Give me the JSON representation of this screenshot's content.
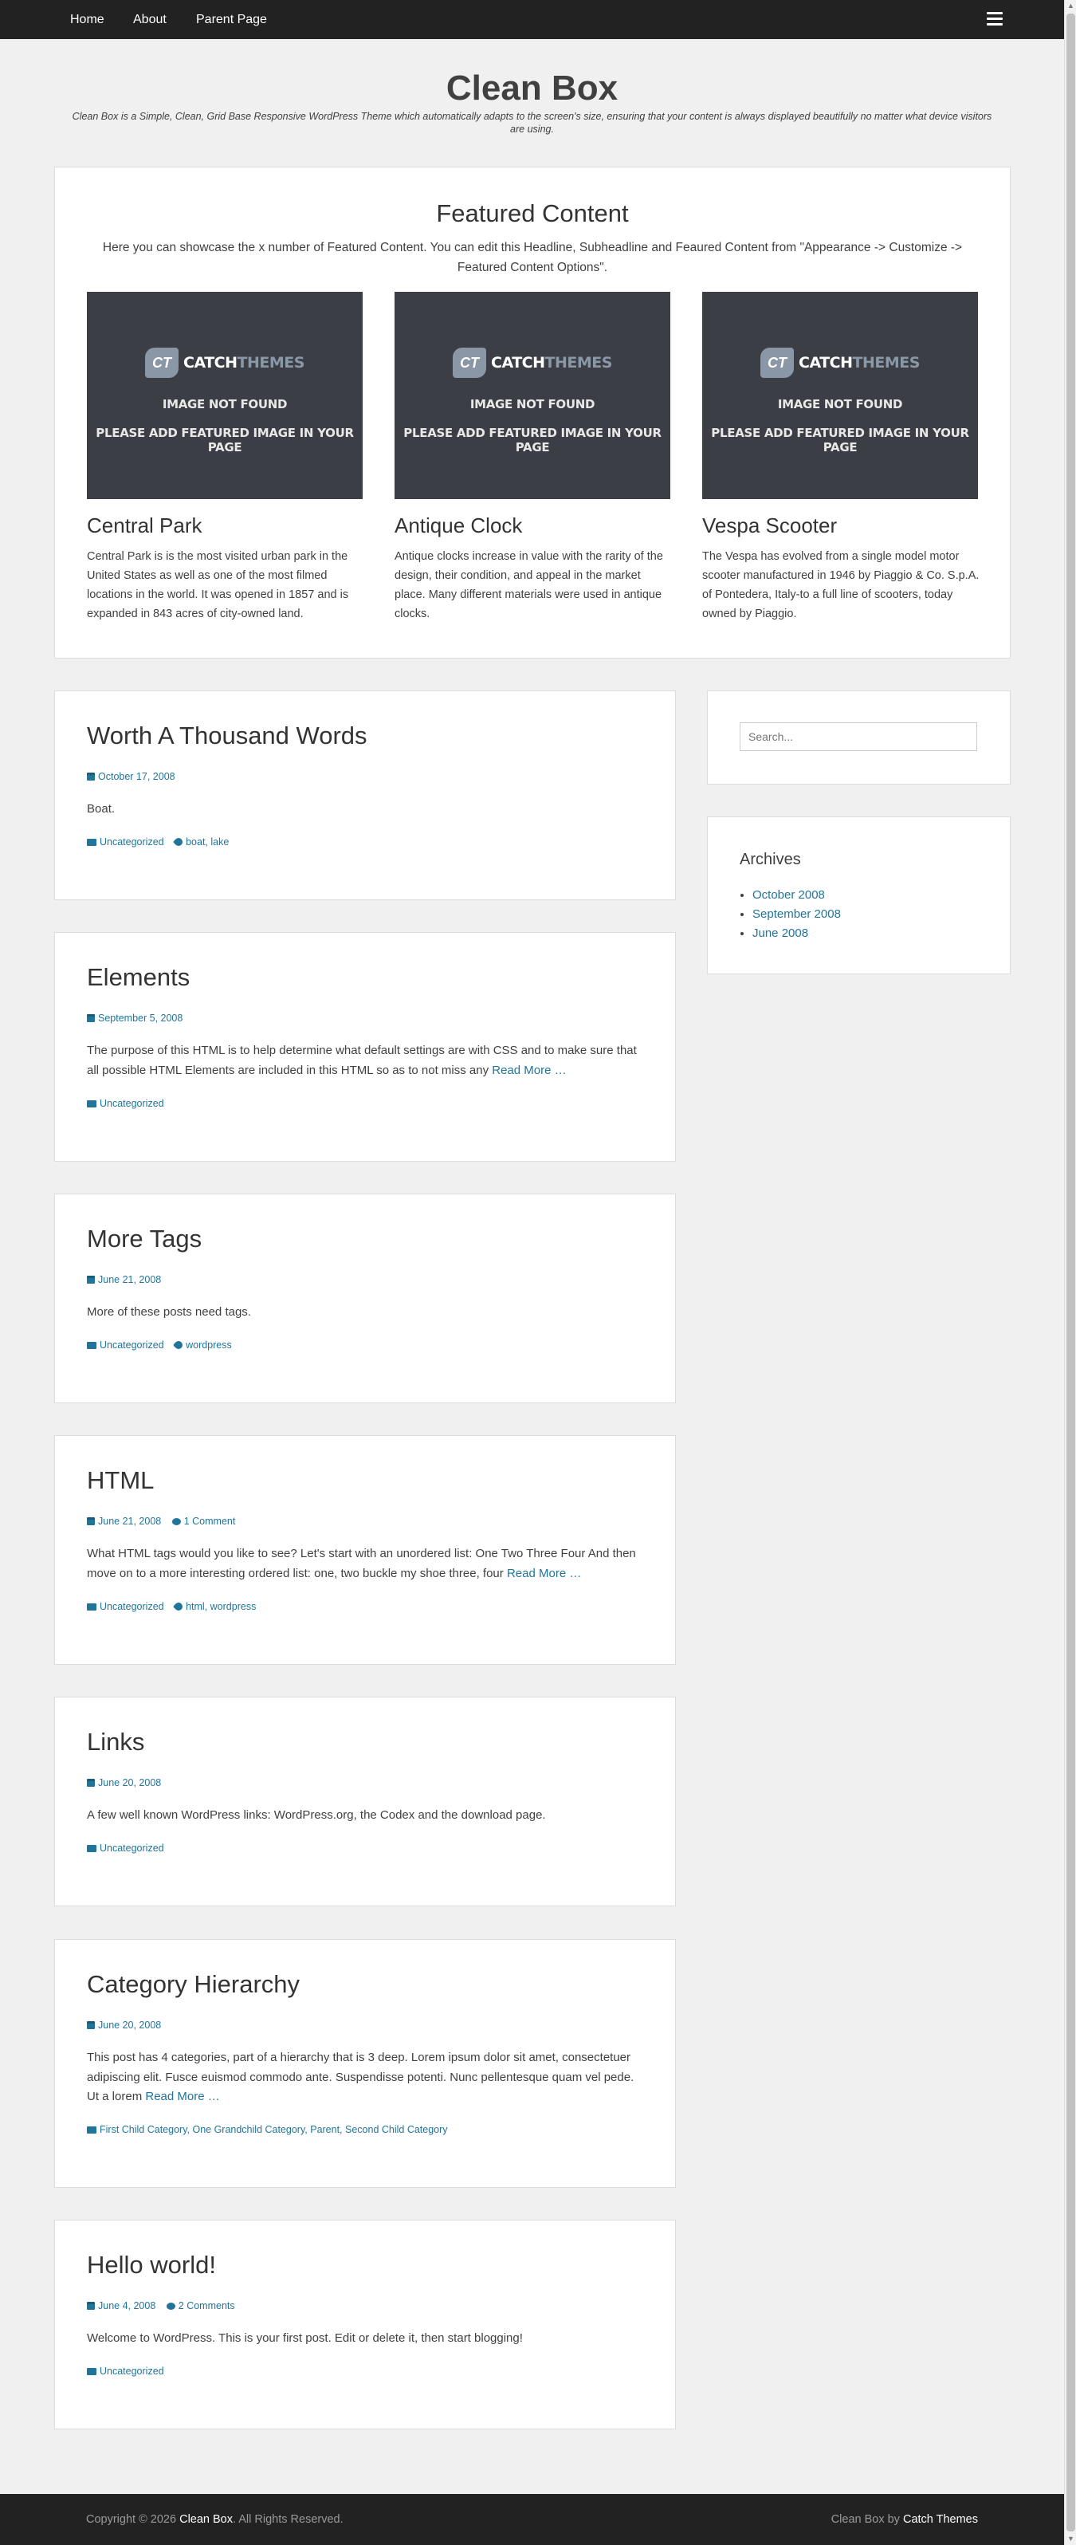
{
  "nav": {
    "items": [
      "Home",
      "About",
      "Parent Page"
    ]
  },
  "site": {
    "title": "Clean Box",
    "description": "Clean Box is a Simple, Clean, Grid Base Responsive WordPress Theme which automatically adapts to the screen's size, ensuring that your content is always displayed beautifully no matter what device visitors are using."
  },
  "featured": {
    "title": "Featured Content",
    "subtitle": "Here you can showcase the x number of Featured Content. You can edit this Headline, Subheadline and Feaured Content from \"Appearance -> Customize -> Featured Content Options\".",
    "placeholder": {
      "logo_badge": "CT",
      "logo_word1": "CATCH",
      "logo_word2": "THEMES",
      "line1": "IMAGE NOT FOUND",
      "line2": "PLEASE ADD FEATURED IMAGE IN YOUR PAGE"
    },
    "items": [
      {
        "title": "Central Park",
        "text": "Central Park is is the most visited urban park in the United States as well as one of the most filmed locations in the world. It was opened in 1857 and is expanded in 843 acres of city-owned land."
      },
      {
        "title": "Antique Clock",
        "text": "Antique clocks increase in value with the rarity of the design, their condition, and appeal in the market place. Many different materials were used in antique clocks."
      },
      {
        "title": "Vespa Scooter",
        "text": "The Vespa has evolved from a single model motor scooter manufactured in 1946 by Piaggio & Co. S.p.A. of Pontedera, Italy-to a full line of scooters, today owned by Piaggio."
      }
    ]
  },
  "read_more": "Read More …",
  "posts": [
    {
      "title": "Worth A Thousand Words",
      "date": "October 17, 2008",
      "excerpt": "Boat.",
      "categories": "Uncategorized",
      "tags": "boat, lake"
    },
    {
      "title": "Elements",
      "date": "September 5, 2008",
      "excerpt": "The purpose of this HTML is to help determine what default settings are with CSS and to make sure that all possible HTML Elements are included in this HTML so as to not miss any",
      "categories": "Uncategorized"
    },
    {
      "title": "More Tags",
      "date": "June 21, 2008",
      "excerpt": "More of these posts need tags.",
      "categories": "Uncategorized",
      "tags": "wordpress"
    },
    {
      "title": "HTML",
      "date": "June 21, 2008",
      "comments": "1 Comment",
      "excerpt": "What HTML tags would you like to see? Let's start with an unordered list: One Two Three Four And then move on to a more interesting ordered list: one, two buckle my shoe three, four",
      "categories": "Uncategorized",
      "tags": "html, wordpress"
    },
    {
      "title": "Links",
      "date": "June 20, 2008",
      "excerpt": "A few well known WordPress links: WordPress.org, the Codex and the download page.",
      "categories": "Uncategorized"
    },
    {
      "title": "Category Hierarchy",
      "date": "June 20, 2008",
      "excerpt": "This post has 4 categories, part of a hierarchy that is 3 deep. Lorem ipsum dolor sit amet, consectetuer adipiscing elit. Fusce euismod commodo ante. Suspendisse potenti. Nunc pellentesque quam vel pede. Ut a lorem",
      "categories": "First Child Category, One Grandchild Category, Parent, Second Child Category"
    },
    {
      "title": "Hello world!",
      "date": "June 4, 2008",
      "comments": "2 Comments",
      "excerpt": "Welcome to WordPress. This is your first post. Edit or delete it, then start blogging!",
      "categories": "Uncategorized"
    }
  ],
  "sidebar": {
    "search_placeholder": "Search...",
    "archives_title": "Archives",
    "archives": [
      "October 2008",
      "September 2008",
      "June 2008"
    ]
  },
  "footer": {
    "copyright_prefix": "Copyright © 2026",
    "site_name": "Clean Box",
    "rights": ". All Rights Reserved.",
    "credit_prefix": "Clean Box by",
    "credit_link": "Catch Themes"
  }
}
